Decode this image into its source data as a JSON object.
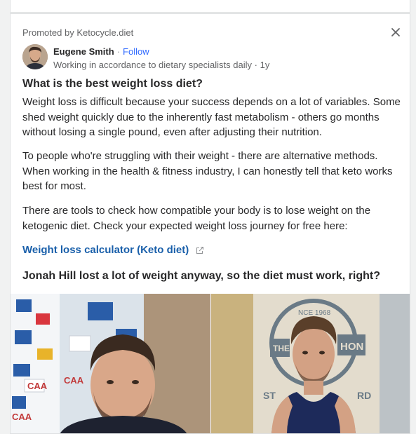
{
  "ad": {
    "promoted_label": "Promoted by Ketocycle.diet"
  },
  "author": {
    "name": "Eugene Smith",
    "separator": "·",
    "follow_label": "Follow",
    "credential": "Working in accordance to dietary specialists daily",
    "time_separator": "·",
    "timestamp": "1y"
  },
  "post": {
    "title": "What is the best weight loss diet?",
    "paragraphs": [
      "Weight loss is difficult because your success depends on a lot of variables. Some shed weight quickly due to the inherently fast metabolism - others go months without losing a single pound, even after adjusting their nutrition.",
      "To people who're struggling with their weight - there are alternative methods. When working in the health & fitness industry, I can honestly tell that keto works best for most.",
      "There are tools to check how compatible your body is to lose weight on the ketogenic diet. Check your expected weight loss journey for free here:"
    ],
    "link_label": "Weight loss calculator (Keto diet)",
    "subheading": "Jonah Hill lost a lot of weight anyway, so the diet must work, right?"
  },
  "images": {
    "left_backdrop_text": [
      "CAA",
      "CAA",
      "CAA"
    ],
    "right_sign_text": [
      "NCE 1968",
      "THE",
      "HON",
      "ST",
      "RD"
    ]
  },
  "icons": {
    "close": "close-icon",
    "external_link": "external-link-icon",
    "avatar": "avatar"
  },
  "colors": {
    "follow": "#2e69ff",
    "link": "#195faa",
    "text": "#282829",
    "muted": "#636466"
  }
}
